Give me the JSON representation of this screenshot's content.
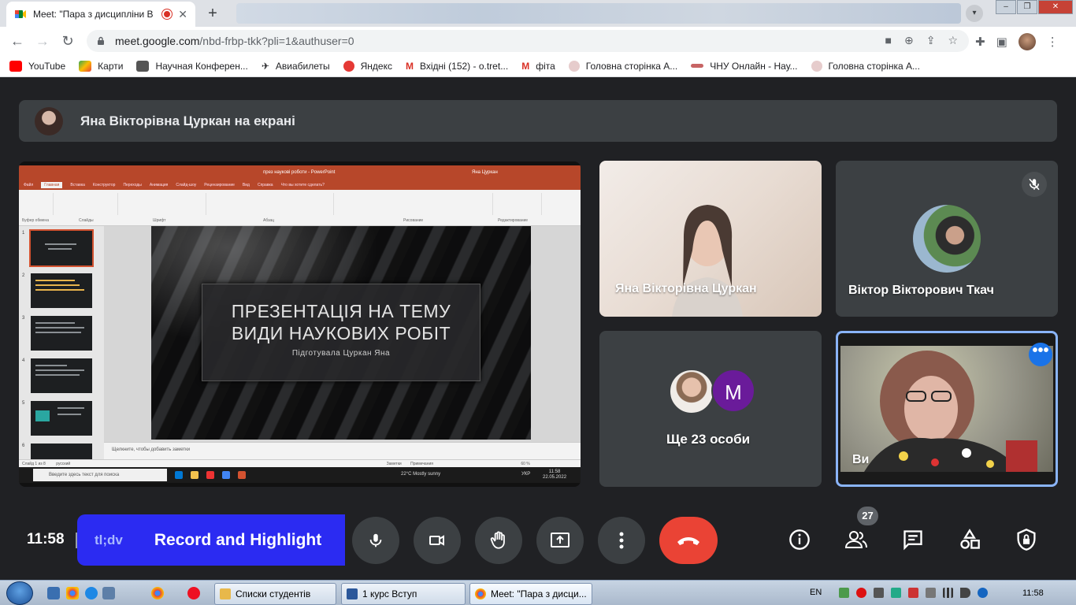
{
  "browser": {
    "tab_title": "Meet: \"Пара з дисципліни В",
    "new_tab": "+",
    "url_host": "meet.google.com",
    "url_path": "/nbd-frbp-tkk?pli=1&authuser=0",
    "bookmarks": [
      {
        "label": "YouTube",
        "icon": "youtube-icon",
        "color": "#ff0000"
      },
      {
        "label": "Карти",
        "icon": "maps-icon",
        "color": "#34a853"
      },
      {
        "label": "Научная Конферен...",
        "icon": "crest-icon",
        "color": "#555555"
      },
      {
        "label": "Авиабилеты",
        "icon": "plane-icon",
        "color": "#333333"
      },
      {
        "label": "Яндекс",
        "icon": "yandex-icon",
        "color": "#e53935"
      },
      {
        "label": "Вхідні (152) - o.tret...",
        "icon": "gmail-icon",
        "color": "#d93025"
      },
      {
        "label": "фіта",
        "icon": "gmail-icon",
        "color": "#d93025"
      },
      {
        "label": "Головна сторінка А...",
        "icon": "site-icon",
        "color": "#c9a2a2"
      },
      {
        "label": "ЧНУ Онлайн - Нау...",
        "icon": "chnu-icon",
        "color": "#c76464"
      },
      {
        "label": "Головна сторінка А...",
        "icon": "site-icon",
        "color": "#c9a2a2"
      }
    ]
  },
  "meet": {
    "presenter_banner": "Яна Вікторівна Цуркан на екрані",
    "shared_screen": {
      "window_title": "през наукові роботи - PowerPoint",
      "user_name": "Яна Цуркан",
      "ribbon_tabs": [
        "Файл",
        "Главная",
        "Вставка",
        "Конструктор",
        "Переходы",
        "Анимация",
        "Слайд-шоу",
        "Рецензирование",
        "Вид",
        "Справка",
        "Что вы хотите сделать?"
      ],
      "active_tab": "Главная",
      "ribbon_groups": [
        "Буфер обмена",
        "Слайды",
        "Шрифт",
        "Абзац",
        "Рисование",
        "Редактирование"
      ],
      "slide_title_line1": "ПРЕЗЕНТАЦІЯ НА ТЕМУ",
      "slide_title_line2": "ВИДИ НАУКОВИХ РОБІТ",
      "slide_subtitle": "Підготувала Цуркан Яна",
      "notes_placeholder": "Щелкните, чтобы добавить заметки",
      "status_left": "Слайд 1 из 8",
      "status_lang": "русский",
      "status_notes": "Заметки",
      "status_comments": "Примечания",
      "zoom": "60 %",
      "taskbar_search": "Введите здесь текст для поиска",
      "weather": "22°C  Mostly sunny",
      "keyboard": "УКР",
      "time": "11:58",
      "date": "22.05.2022"
    },
    "tiles": [
      {
        "name": "Яна Вікторівна Цуркан"
      },
      {
        "name": "Віктор Вікторович Ткач",
        "muted": true
      },
      {
        "name": "Ще 23 особи",
        "avatar_letter": "M",
        "avatar_color": "#6a1b9a"
      },
      {
        "name": "Ви",
        "more_label": "•••"
      }
    ],
    "clock": "11:58",
    "extension_logo": "tl;dv",
    "extension_title": "Record and Highlight",
    "participants_count": "27",
    "accent": "#8ab4f8",
    "end_call_color": "#ea4335"
  },
  "taskbar": {
    "tasks": [
      {
        "label": "Списки студентів",
        "icon": "folder-icon",
        "color": "#e8b84a"
      },
      {
        "label": "1 курс Вступ",
        "icon": "word-icon",
        "color": "#2b579a"
      },
      {
        "label": "Meet: \"Пара з дисци...",
        "icon": "chrome-icon",
        "color": "#4285f4"
      }
    ],
    "language": "EN",
    "time": "11:58"
  }
}
